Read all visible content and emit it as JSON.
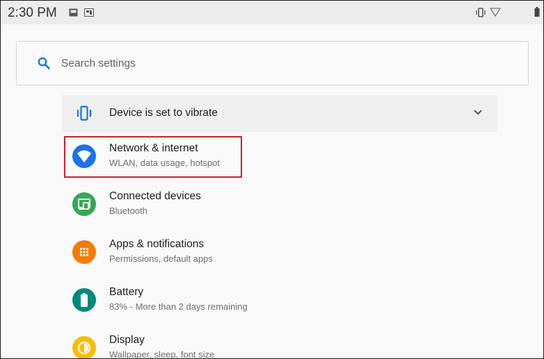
{
  "status_bar": {
    "time": "2:30 PM",
    "icons": [
      "image-icon",
      "notification-icon",
      "vibrate-icon",
      "wifi-icon",
      "battery-icon"
    ]
  },
  "search": {
    "placeholder": "Search settings"
  },
  "banner": {
    "text": "Device is set to vibrate",
    "icon": "vibrate-icon"
  },
  "settings": [
    {
      "title": "Network & internet",
      "subtitle": "WLAN, data usage, hotspot",
      "icon": "wifi-icon",
      "color": "#1a73e8",
      "highlighted": true
    },
    {
      "title": "Connected devices",
      "subtitle": "Bluetooth",
      "icon": "devices-icon",
      "color": "#35a853"
    },
    {
      "title": "Apps & notifications",
      "subtitle": "Permissions, default apps",
      "icon": "apps-icon",
      "color": "#f57c00"
    },
    {
      "title": "Battery",
      "subtitle": "83% - More than 2 days remaining",
      "icon": "battery-icon",
      "color": "#00897b"
    },
    {
      "title": "Display",
      "subtitle": "Wallpaper, sleep, font size",
      "icon": "brightness-icon",
      "color": "#fbbc04"
    }
  ],
  "colors": {
    "highlight_border": "#cc1f2d",
    "accent": "#1a73e8"
  }
}
